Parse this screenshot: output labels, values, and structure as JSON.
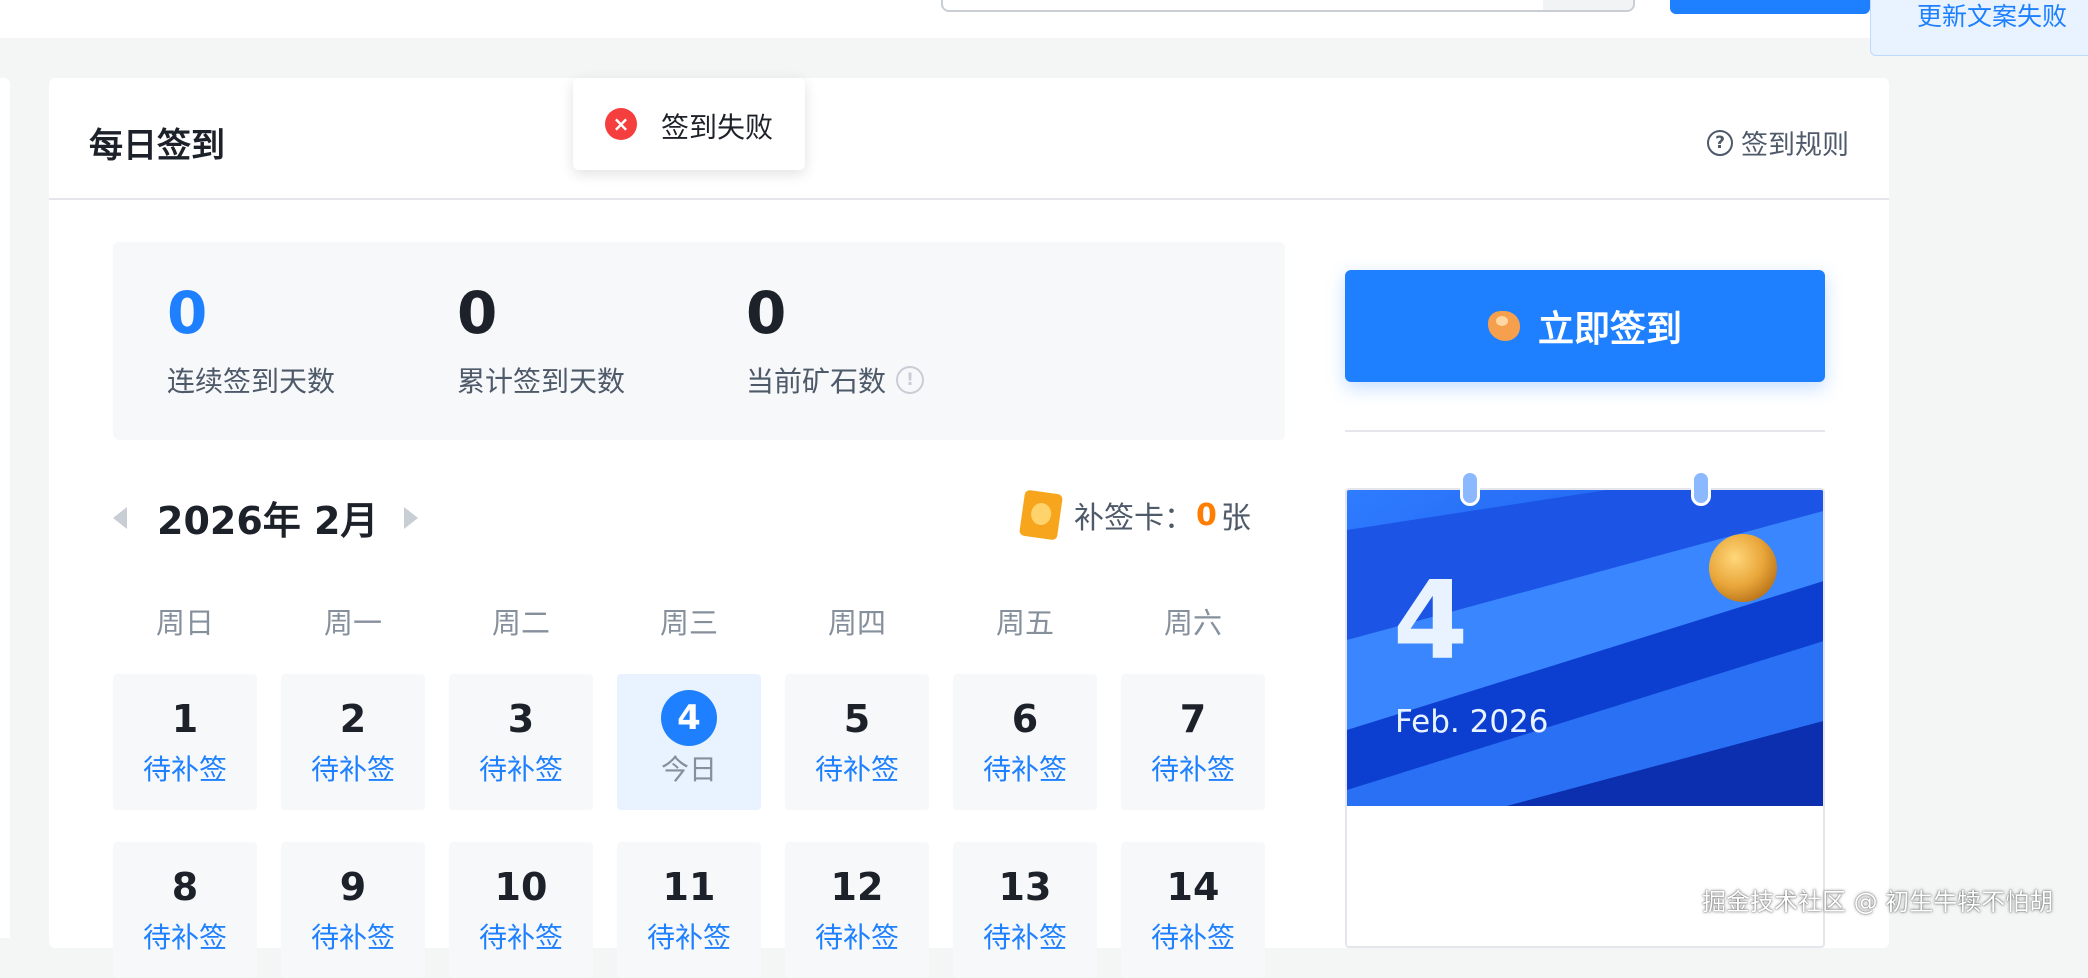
{
  "notification": {
    "text": "更新文案失败"
  },
  "panel": {
    "title": "每日签到",
    "rules_label": "签到规则"
  },
  "toast": {
    "text": "签到失败",
    "icon": "error-x-icon"
  },
  "stats": {
    "consecutive": {
      "value": "0",
      "label": "连续签到天数"
    },
    "total": {
      "value": "0",
      "label": "累计签到天数"
    },
    "ore": {
      "value": "0",
      "label": "当前矿石数"
    }
  },
  "calendar": {
    "month_title": "2026年 2月",
    "makeup_card": {
      "label": "补签卡：",
      "count": "0",
      "unit": "张"
    },
    "weekdays": [
      "周日",
      "周一",
      "周二",
      "周三",
      "周四",
      "周五",
      "周六"
    ],
    "rows": [
      [
        {
          "day": "1",
          "status": "待补签"
        },
        {
          "day": "2",
          "status": "待补签"
        },
        {
          "day": "3",
          "status": "待补签"
        },
        {
          "day": "4",
          "status": "今日",
          "today": true
        },
        {
          "day": "5",
          "status": "待补签"
        },
        {
          "day": "6",
          "status": "待补签"
        },
        {
          "day": "7",
          "status": "待补签"
        }
      ],
      [
        {
          "day": "8",
          "status": "待补签"
        },
        {
          "day": "9",
          "status": "待补签"
        },
        {
          "day": "10",
          "status": "待补签"
        },
        {
          "day": "11",
          "status": "待补签"
        },
        {
          "day": "12",
          "status": "待补签"
        },
        {
          "day": "13",
          "status": "待补签"
        },
        {
          "day": "14",
          "status": "待补签"
        }
      ]
    ]
  },
  "checkin_button": {
    "label": "立即签到"
  },
  "date_card": {
    "day": "4",
    "month": "Feb. 2026"
  },
  "watermark": "掘金技术社区 @ 初生牛犊不怕胡",
  "colors": {
    "accent": "#1e80ff",
    "error": "#f53f3f",
    "orange": "#ff7d00"
  }
}
